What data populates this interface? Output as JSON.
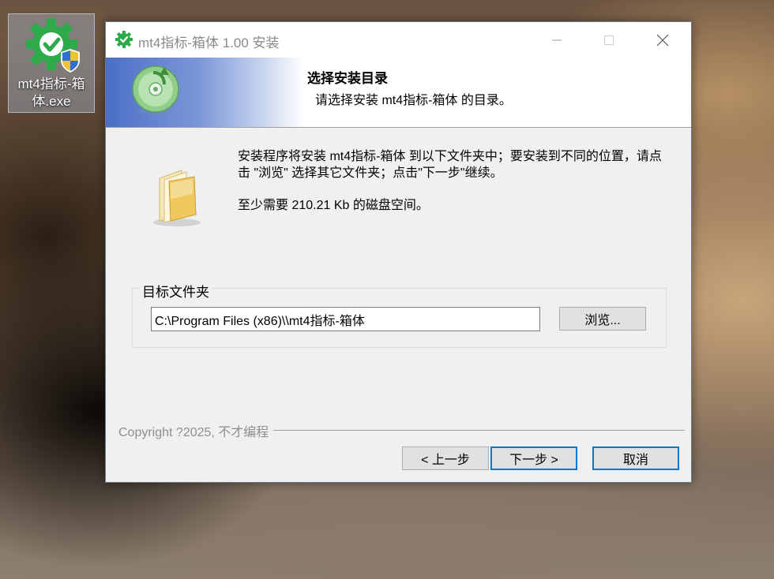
{
  "desktop": {
    "icon_label": "mt4指标-箱体.exe",
    "icon": "installer-gear-shield-icon"
  },
  "window": {
    "title": "mt4指标-箱体 1.00 安装",
    "icon": "green-gear-check-icon",
    "minimize_icon": "minimize-icon",
    "maximize_icon": "maximize-icon",
    "close_icon": "close-icon"
  },
  "header": {
    "title": "选择安装目录",
    "subtitle": "请选择安装 mt4指标-箱体 的目录。",
    "icon": "cd-install-icon"
  },
  "body": {
    "description": "安装程序将安装 mt4指标-箱体 到以下文件夹中；要安装到不同的位置，请点击 \"浏览\" 选择其它文件夹；点击\"下一步\"继续。",
    "space_required": "至少需要 210.21 Kb 的磁盘空间。",
    "folder_icon": "folder-icon"
  },
  "destination": {
    "group_label": "目标文件夹",
    "path": "C:\\Program Files (x86)\\\\mt4指标-箱体",
    "browse_label": "浏览..."
  },
  "footer": {
    "copyright": "Copyright ?2025, 不才编程",
    "back_label": "< 上一步",
    "next_label": "下一步 >",
    "cancel_label": "取消"
  },
  "colors": {
    "accent": "#0078d7",
    "icon_green": "#2ea043",
    "header_blue": "#4b6fc7"
  }
}
